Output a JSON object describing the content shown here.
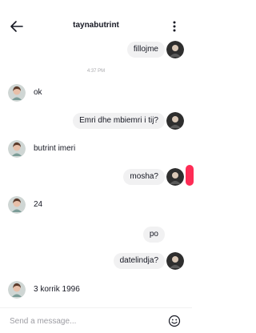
{
  "header": {
    "title": "taynabutrint"
  },
  "timestamp": "4:37 PM",
  "messages": [
    {
      "side": "out",
      "text": "fillojme"
    },
    {
      "side": "in",
      "text": "ok"
    },
    {
      "side": "out",
      "text": "Emri dhe mbiemri i tij?"
    },
    {
      "side": "in",
      "text": "butrint imeri"
    },
    {
      "side": "out",
      "text": "mosha?"
    },
    {
      "side": "in",
      "text": "24"
    },
    {
      "side": "out",
      "text": "po"
    },
    {
      "side": "out",
      "text": "datelindja?"
    },
    {
      "side": "in",
      "text": "3 korrik 1996"
    }
  ],
  "composer": {
    "placeholder": "Send a message..."
  },
  "colors": {
    "accent": "#fe2c55",
    "bubble": "#f1f1f2",
    "text": "#161823",
    "muted": "#a9a9ad"
  },
  "icons": {
    "back": "arrow-left-icon",
    "more": "more-vertical-icon",
    "emoji": "emoji-icon"
  }
}
